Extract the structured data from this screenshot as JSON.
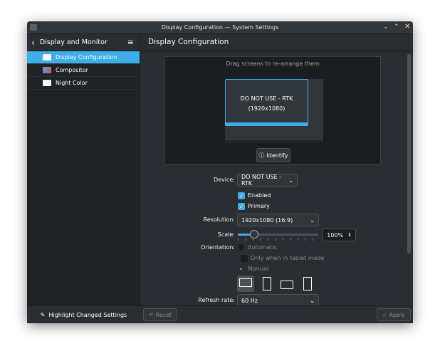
{
  "window": {
    "title": "Display Configuration — System Settings",
    "controls": [
      "minimize",
      "maximize",
      "close"
    ]
  },
  "sidebar": {
    "back_title": "Display and Monitor",
    "items": [
      {
        "label": "Display Configuration",
        "selected": true
      },
      {
        "label": "Compositor"
      },
      {
        "label": "Night Color"
      }
    ],
    "highlight_label": "Highlight Changed Settings"
  },
  "main": {
    "title": "Display Configuration",
    "preview": {
      "hint": "Drag screens to re-arrange them",
      "screen_name": "DO NOT USE - RTK",
      "screen_res": "(1920x1080)",
      "identify_label": "Identify"
    },
    "form": {
      "device_label": "Device:",
      "device_value": "DO NOT USE - RTK",
      "enabled_label": "Enabled",
      "enabled": true,
      "primary_label": "Primary",
      "primary": true,
      "resolution_label": "Resolution:",
      "resolution_value": "1920x1080 (16:9)",
      "scale_label": "Scale:",
      "scale_value": "100%",
      "scale_fraction": 0.2,
      "orientation_label": "Orientation:",
      "automatic_label": "Automatic",
      "tablet_label": "Only when in tablet mode",
      "manual_label": "Manual",
      "refresh_label": "Refresh rate:",
      "refresh_value": "60 Hz"
    },
    "footer": {
      "reset_label": "Reset",
      "apply_label": "Apply"
    }
  },
  "colors": {
    "accent": "#3daee9",
    "bg": "#2a2e32"
  }
}
